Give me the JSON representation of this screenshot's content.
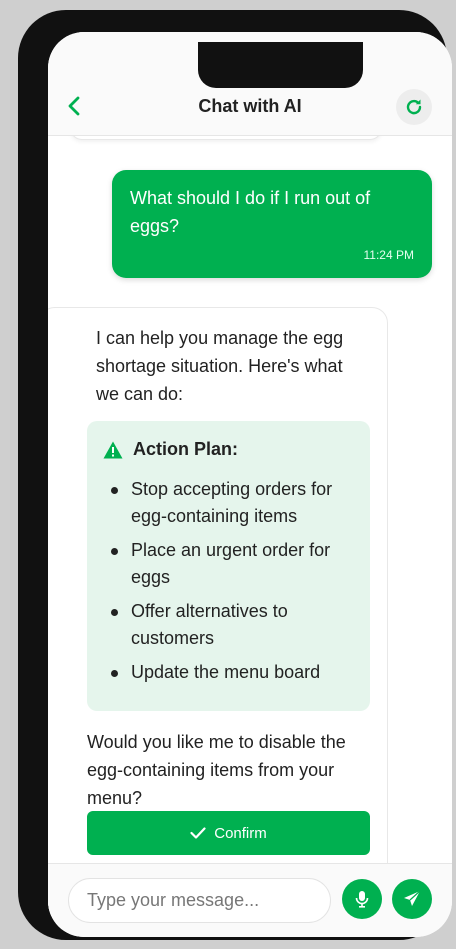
{
  "header": {
    "title": "Chat with AI"
  },
  "messages": {
    "user": {
      "text": "What should I do if I run out of eggs?",
      "time": "11:24 PM"
    },
    "ai": {
      "intro": "I can help you manage the egg shortage situation. Here's what we can do:",
      "action_title": "Action Plan:",
      "action_items": [
        "Stop accepting orders for egg-containing items",
        "Place an urgent order for eggs",
        "Offer alternatives to customers",
        "Update the menu board"
      ],
      "question": "Would you like me to disable the egg-containing items from your menu?",
      "confirm_label": "Confirm"
    }
  },
  "composer": {
    "placeholder": "Type your message..."
  },
  "colors": {
    "accent": "#00b050",
    "action_card_bg": "#e5f5ec",
    "phone_frame": "#111111"
  }
}
